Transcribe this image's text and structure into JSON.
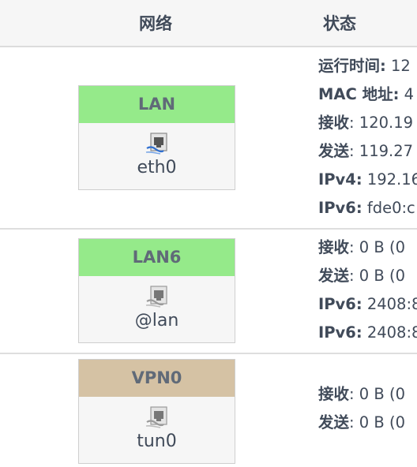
{
  "header": {
    "network_label": "网络",
    "status_label": "状态"
  },
  "interfaces": [
    {
      "name": "LAN",
      "device": "eth0",
      "color": "#95ea8a",
      "icon": "ethernet-port-icon",
      "status": [
        {
          "key": "运行时间:",
          "value": " 12"
        },
        {
          "key": "MAC 地址:",
          "value": " 4"
        },
        {
          "key": "接收",
          "value": ": 120.19"
        },
        {
          "key": "发送",
          "value": ": 119.27"
        },
        {
          "key": "IPv4:",
          "value": " 192.16"
        },
        {
          "key": "IPv6:",
          "value": " fde0:c"
        }
      ]
    },
    {
      "name": "LAN6",
      "device": "@lan",
      "color": "#95ea8a",
      "icon": "ethernet-port-icon",
      "status": [
        {
          "key": "接收",
          "value": ": 0 B (0"
        },
        {
          "key": "发送",
          "value": ": 0 B (0"
        },
        {
          "key": "IPv6:",
          "value": " 2408:8"
        },
        {
          "key": "IPv6:",
          "value": " 2408:8"
        }
      ]
    },
    {
      "name": "VPN0",
      "device": "tun0",
      "color": "#d5c2a4",
      "icon": "ethernet-port-icon",
      "status": [
        {
          "key": "接收",
          "value": ": 0 B (0"
        },
        {
          "key": "发送",
          "value": ": 0 B (0"
        }
      ]
    }
  ]
}
